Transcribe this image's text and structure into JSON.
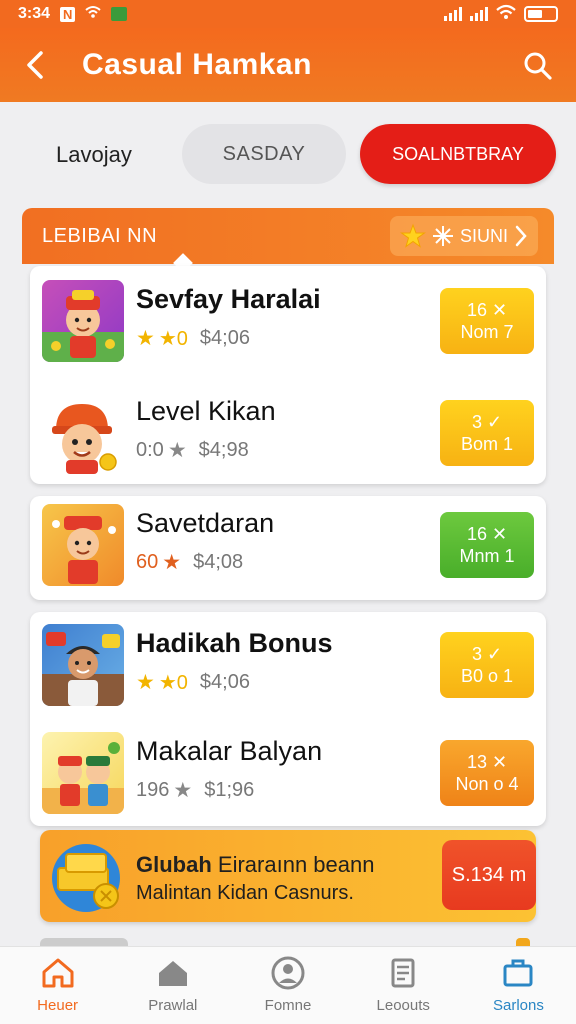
{
  "status_bar": {
    "time": "3:34",
    "left_badge": "N"
  },
  "header": {
    "title": "Casual Hamkan"
  },
  "filter": {
    "label": "Lavojay",
    "middle": "SASDAY",
    "active": "SOALNBTBRAY"
  },
  "section": {
    "title": "LEBIBAI NN",
    "action": "SIUNI"
  },
  "items": [
    {
      "title": "Sevfay Haralai",
      "rating": "★0",
      "price": "$4;06",
      "badge_top": "16 ✕",
      "badge_bottom": "Nom 7"
    },
    {
      "title": "Level Kikan",
      "rating": "0:0",
      "price": "$4;98",
      "badge_top": "3 ✓",
      "badge_bottom": "Bom 1"
    },
    {
      "title": "Savetdaran",
      "rating": "60",
      "price": "$4;08",
      "badge_top": "16 ✕",
      "badge_bottom": "Mnm 1"
    },
    {
      "title": "Hadikah Bonus",
      "rating": "★0",
      "price": "$4;06",
      "badge_top": "3 ✓",
      "badge_bottom": "B0 o 1"
    },
    {
      "title": "Makalar Balyan",
      "rating": "196",
      "price": "$1;96",
      "badge_top": "13 ✕",
      "badge_bottom": "Non o 4"
    }
  ],
  "promo": {
    "line1_bold": "Glubah",
    "line1_rest": "Eiraraınn beann",
    "line2": "Malintan Kidan Casnurs.",
    "button": "S.134 m"
  },
  "nav": [
    {
      "label": "Heuer"
    },
    {
      "label": "Prawlal"
    },
    {
      "label": "Fomne"
    },
    {
      "label": "Leoouts"
    },
    {
      "label": "Sarlons"
    }
  ],
  "colors": {
    "primary": "#f26a1f",
    "red": "#e41e17",
    "yellow": "#f7b213",
    "green": "#49ae2a",
    "orange": "#ef8318",
    "blue": "#2a86c4"
  }
}
